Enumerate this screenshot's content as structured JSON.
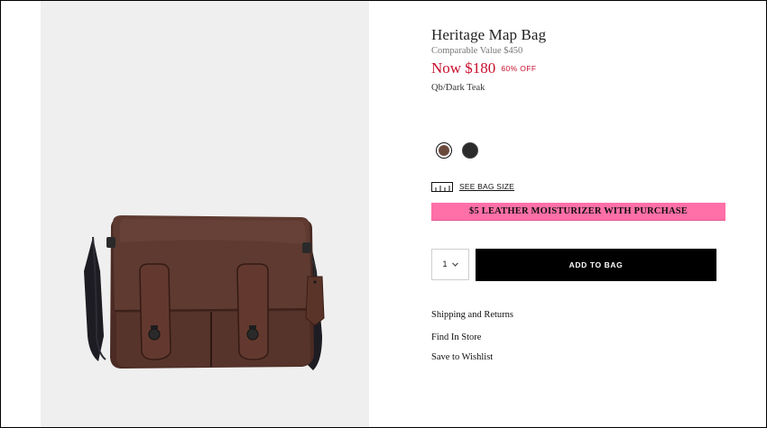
{
  "product": {
    "title": "Heritage Map Bag",
    "comparable_value": "Comparable Value $450",
    "price_now": "Now  $180",
    "discount": "60% OFF",
    "color_name": "Qb/Dark Teak"
  },
  "swatches": [
    {
      "name": "brown",
      "color": "#6b4a3e",
      "selected": true
    },
    {
      "name": "black",
      "color": "#2b2b2b",
      "selected": false
    }
  ],
  "size": {
    "icon": "ruler-icon",
    "link_label": "SEE BAG SIZE"
  },
  "promo": {
    "text": "$5 LEATHER MOISTURIZER WITH PURCHASE",
    "background": "#ff6fa8"
  },
  "purchase": {
    "quantity": "1",
    "add_label": "ADD TO BAG"
  },
  "links": {
    "shipping": "Shipping and Returns",
    "find_store": "Find In Store",
    "wishlist": "Save to Wishlist"
  },
  "colors": {
    "sale_red": "#c8102e",
    "image_background": "#efefef"
  }
}
